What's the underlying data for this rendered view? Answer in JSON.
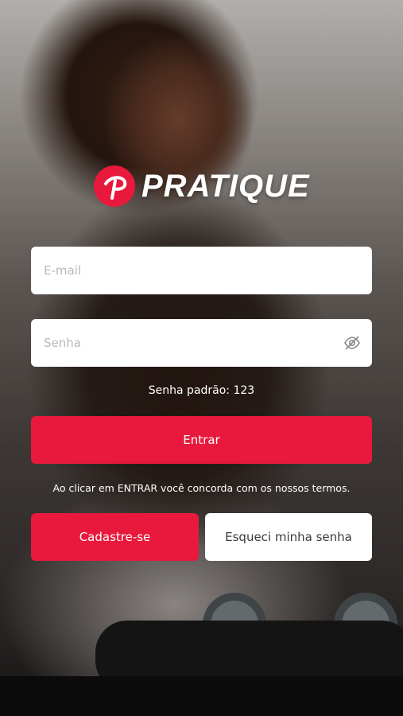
{
  "app": {
    "brand": "PRATIQUE",
    "brand_color": "#e8193c"
  },
  "login": {
    "email_placeholder": "E-mail",
    "email_value": "",
    "password_placeholder": "Senha",
    "password_value": "",
    "password_toggle_icon": "eye-off-icon",
    "default_password_hint": "Senha padrão: 123",
    "submit_label": "Entrar",
    "terms_text": "Ao clicar em ENTRAR você concorda com os nossos termos.",
    "register_label": "Cadastre-se",
    "forgot_label": "Esqueci minha senha"
  }
}
